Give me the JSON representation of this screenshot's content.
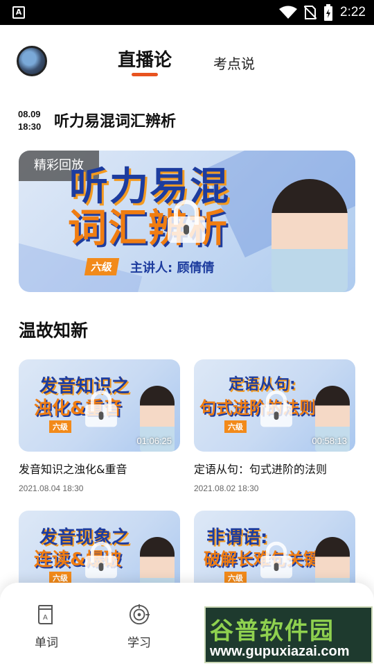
{
  "status_bar": {
    "time": "2:22",
    "left_icon": "A"
  },
  "header": {
    "tabs": [
      {
        "label": "直播论",
        "active": true
      },
      {
        "label": "考点说",
        "active": false
      }
    ],
    "accent_color": "#e8531f"
  },
  "live": {
    "date": "08.09",
    "time": "18:30",
    "title": "听力易混词汇辨析",
    "badge": "精彩回放",
    "cover_line1": "听力易混",
    "cover_line2": "词汇辨析",
    "cover_level": "六级",
    "cover_host": "主讲人: 顾倩倩",
    "locked": true
  },
  "section": {
    "title": "温故知新"
  },
  "videos": [
    {
      "cover_line1": "发音知识之",
      "cover_line2": "浊化&重音",
      "cover_level": "六级",
      "duration": "01:06:25",
      "title": "发音知识之浊化&重音",
      "date": "2021.08.04 18:30",
      "locked": true
    },
    {
      "cover_line1": "定语从句:",
      "cover_line2": "句式进阶的法则",
      "cover_level": "六级",
      "duration": "00:58:13",
      "title": "定语从句：句式进阶的法则",
      "date": "2021.08.02 18:30",
      "locked": true
    },
    {
      "cover_line1": "发音现象之",
      "cover_line2": "连读&爆破",
      "cover_level": "六级",
      "locked": true
    },
    {
      "cover_line1": "非谓语:",
      "cover_line2": "破解长难句关键",
      "cover_level": "六级",
      "locked": true
    }
  ],
  "bottom_nav": [
    {
      "label": "单词",
      "icon": "book-icon"
    },
    {
      "label": "学习",
      "icon": "target-icon"
    }
  ],
  "watermark": {
    "line1": "谷普软件园",
    "line2": "www.gupuxiazai.com"
  }
}
